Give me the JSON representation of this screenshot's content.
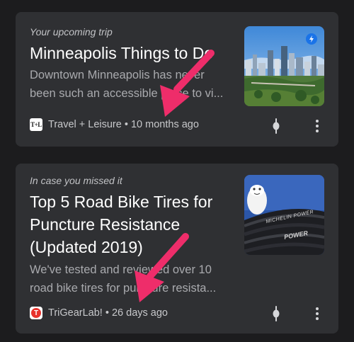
{
  "cards": [
    {
      "kicker": "Your upcoming trip",
      "headline": [
        "Minneapolis Things to Do"
      ],
      "snippet": [
        "Downtown Minneapolis has never",
        "been such an accessible place to vi..."
      ],
      "publisher": "Travel + Leisure",
      "age": "10 months ago",
      "separator": " • ",
      "logo_text": "T+L",
      "thumb_badge_icon": "bolt-icon"
    },
    {
      "kicker": "In case you missed it",
      "headline": [
        "Top 5 Road Bike Tires for",
        "Puncture Resistance",
        "(Updated 2019)"
      ],
      "snippet": [
        "We've tested and reviewed over 10",
        "road bike tires for puncture resista..."
      ],
      "publisher": "TriGearLab!",
      "age": "26 days ago",
      "separator": " • ",
      "logo_text": "T",
      "thumb_text_1": "MICHELIN POWER",
      "thumb_text_2": "POWER"
    }
  ],
  "colors": {
    "background": "#1c1c1e",
    "card": "#2f3033",
    "annotation_arrow": "#ee2d6a"
  },
  "icons": {
    "interest": "interest-icon",
    "more": "more-vert-icon"
  }
}
